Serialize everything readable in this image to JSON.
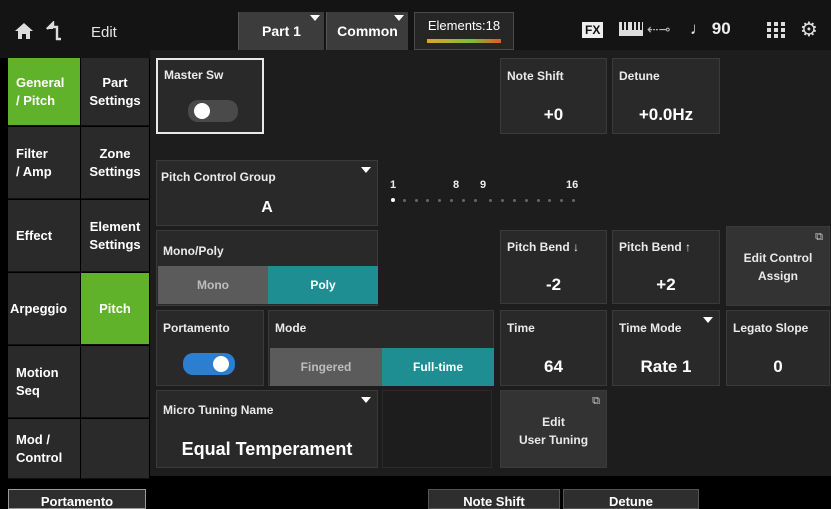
{
  "header": {
    "home_icon": "home-icon",
    "back_icon": "back-arrow-icon",
    "title": "Edit",
    "tabs": [
      {
        "label": "Part 1"
      },
      {
        "label": "Common"
      }
    ],
    "elements_label": "Elements:18",
    "fx_label": "FX",
    "tempo": "90",
    "tempo_icon": "note-icon",
    "keyboard_icon": "keyboard-icon",
    "usb_icon": "usb-icon",
    "grid_icon": "grid-icon",
    "settings_icon": "gear-icon"
  },
  "nav_main": [
    {
      "line1": "General",
      "line2": "/ Pitch",
      "active": true
    },
    {
      "line1": "Filter",
      "line2": "/ Amp",
      "active": false
    },
    {
      "line1": "Effect",
      "line2": "",
      "active": false
    },
    {
      "line1": "Arpeggio",
      "line2": "",
      "active": false
    },
    {
      "line1": "Motion",
      "line2": "Seq",
      "active": false
    },
    {
      "line1": "Mod /",
      "line2": "Control",
      "active": false
    }
  ],
  "nav_sub": [
    {
      "line1": "Part",
      "line2": "Settings",
      "active": false
    },
    {
      "line1": "Zone",
      "line2": "Settings",
      "active": false
    },
    {
      "line1": "Element",
      "line2": "Settings",
      "active": false
    },
    {
      "line1": "Pitch",
      "line2": "",
      "active": true
    },
    {
      "line1": "",
      "line2": "",
      "active": false
    },
    {
      "line1": "",
      "line2": "",
      "active": false
    }
  ],
  "master_sw": {
    "label": "Master Sw",
    "state": "off"
  },
  "note_shift": {
    "label": "Note Shift",
    "value": "+0"
  },
  "detune": {
    "label": "Detune",
    "value": "+0.0Hz"
  },
  "pitch_control_group": {
    "label": "Pitch Control Group",
    "value": "A",
    "scale_labels": [
      "1",
      "8",
      "9",
      "16"
    ]
  },
  "mono_poly": {
    "label": "Mono/Poly",
    "options": [
      "Mono",
      "Poly"
    ],
    "selected": "Poly"
  },
  "pitch_bend_down": {
    "label": "Pitch Bend ↓",
    "value": "-2"
  },
  "pitch_bend_up": {
    "label": "Pitch Bend ↑",
    "value": "+2"
  },
  "edit_control_assign": {
    "label_line1": "Edit Control",
    "label_line2": "Assign"
  },
  "portamento": {
    "label": "Portamento",
    "state": "on"
  },
  "mode": {
    "label": "Mode",
    "options": [
      "Fingered",
      "Full-time"
    ],
    "selected": "Full-time"
  },
  "time": {
    "label": "Time",
    "value": "64"
  },
  "time_mode": {
    "label": "Time Mode",
    "value": "Rate 1"
  },
  "legato_slope": {
    "label": "Legato Slope",
    "value": "0"
  },
  "micro_tuning": {
    "label": "Micro Tuning Name",
    "value": "Equal Temperament"
  },
  "edit_user_tuning": {
    "label_line1": "Edit",
    "label_line2": "User Tuning"
  },
  "bottom": {
    "left_button": "Portamento",
    "buttons": [
      "Note Shift",
      "Detune"
    ]
  }
}
